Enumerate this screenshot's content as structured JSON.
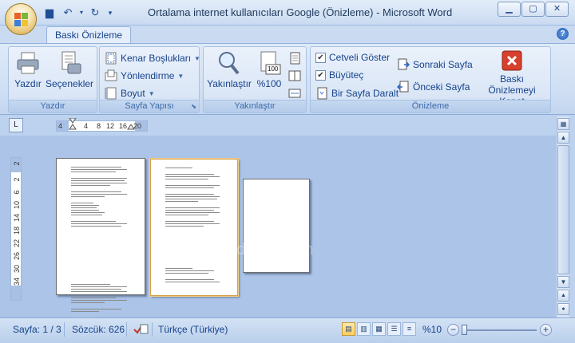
{
  "window": {
    "title": "Ortalama internet kullanıcıları Google (Önizleme) - Microsoft Word"
  },
  "qat": {
    "save_icon": "save-icon",
    "undo_icon": "undo-icon",
    "redo_icon": "redo-icon",
    "customize_icon": "customize-qat-icon"
  },
  "tabs": [
    {
      "label": "Baskı Önizleme"
    }
  ],
  "ribbon": {
    "print_group": {
      "label": "Yazdır",
      "print": "Yazdır",
      "options": "Seçenekler"
    },
    "page_setup_group": {
      "label": "Sayfa Yapısı",
      "margins": "Kenar Boşlukları",
      "orientation": "Yönlendirme",
      "size": "Boyut"
    },
    "zoom_group": {
      "label": "Yakınlaştır",
      "zoom": "Yakınlaştır",
      "hundred": "%100",
      "icon100": "100"
    },
    "preview_group": {
      "label": "Önizleme",
      "show_ruler": "Cetveli Göster",
      "magnifier": "Büyüteç",
      "shrink_one_page": "Bir Sayfa Daralt",
      "next_page": "Sonraki Sayfa",
      "prev_page": "Önceki Sayfa",
      "close_preview_line1": "Baskı Önizlemeyi",
      "close_preview_line2": "Kapat"
    }
  },
  "ruler": {
    "corner": "L",
    "h_ticks": [
      "4",
      "4",
      "8",
      "12",
      "16",
      "20"
    ],
    "v_ticks": [
      "2",
      "2",
      "6",
      "10",
      "14",
      "18",
      "22",
      "26",
      "30",
      "34"
    ]
  },
  "watermark": "digitalders.com",
  "statusbar": {
    "page": "Sayfa: 1 / 3",
    "words": "Sözcük: 626",
    "language": "Türkçe (Türkiye)",
    "zoom": "%10"
  },
  "colors": {
    "ribbon_bg": "#cfdef3",
    "workspace": "#abc4e7",
    "close_red": "#d7402c",
    "accent_text": "#15428b"
  }
}
